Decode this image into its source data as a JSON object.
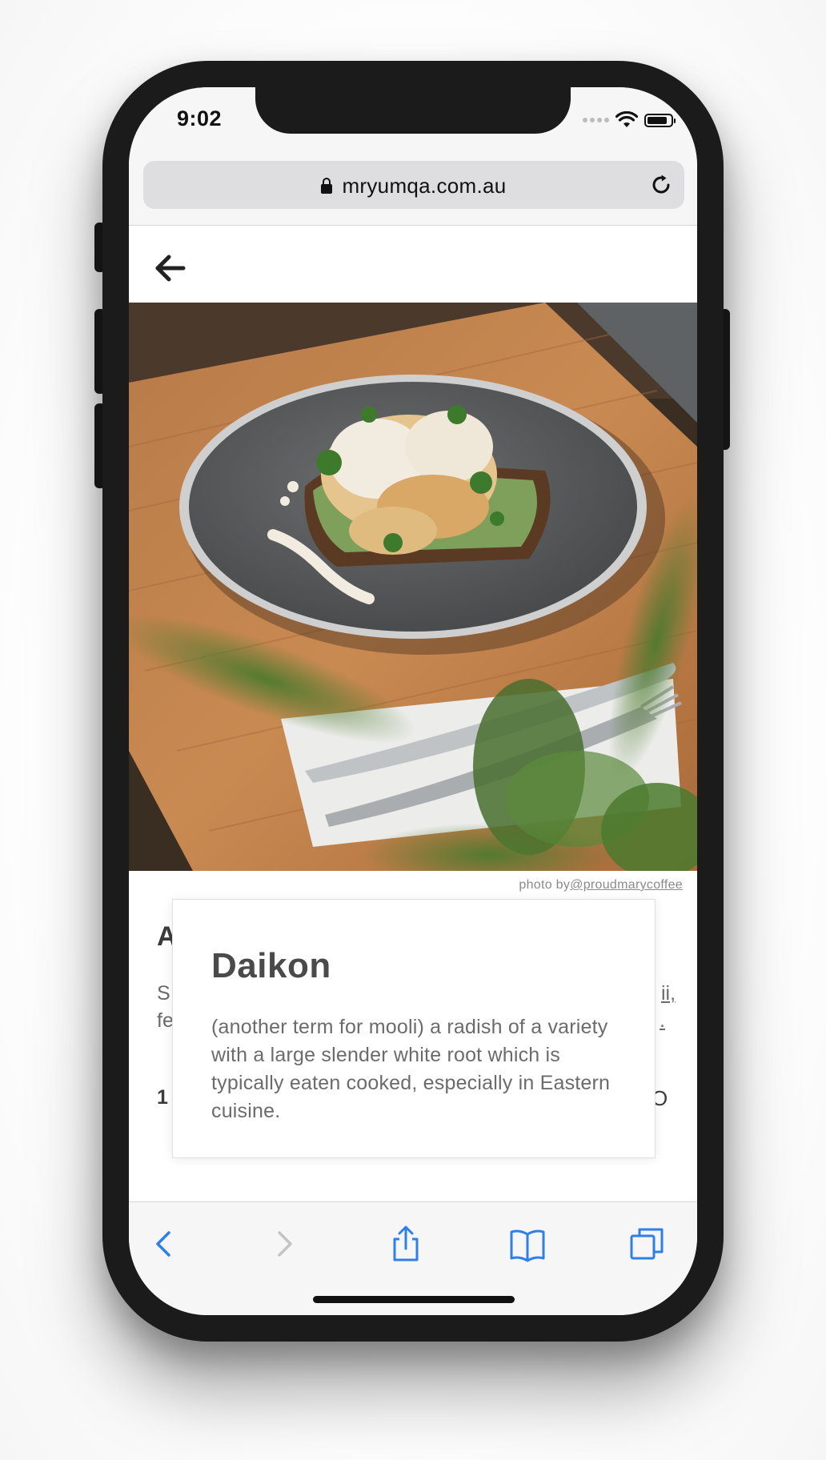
{
  "status_bar": {
    "time": "9:02"
  },
  "browser": {
    "url": "mryumqa.com.au"
  },
  "photo": {
    "credit_prefix": "photo by",
    "credit_handle": "@proudmarycoffee"
  },
  "article": {
    "title_visible": "A",
    "line1_start": "S",
    "line1_end": "ii,",
    "line2_start": "fe",
    "line2_end": ".",
    "price_start": "1",
    "price_end": "O"
  },
  "popover": {
    "term": "Daikon",
    "definition": "(another term for mooli) a radish of a variety with a large slender white root which is typically eaten cooked, especially in Eastern cuisine."
  },
  "colors": {
    "toolbar_accent": "#2f7fea",
    "toolbar_disabled": "#c4c4c4"
  }
}
